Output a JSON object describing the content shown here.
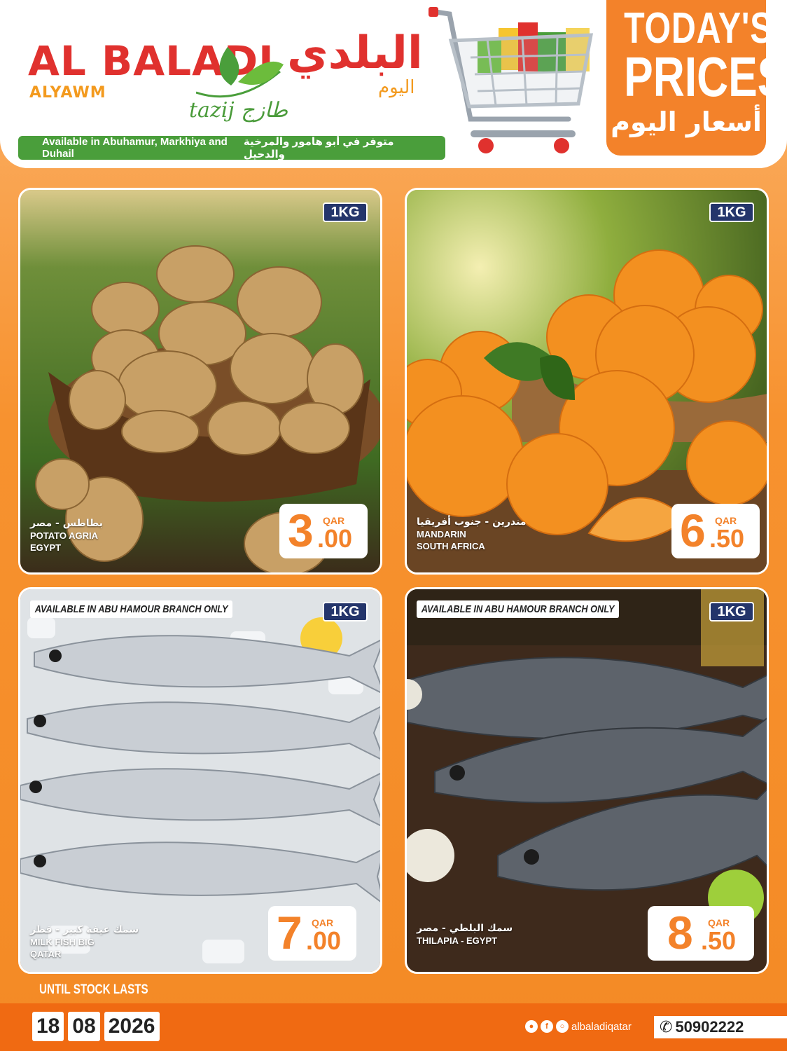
{
  "header": {
    "brand_en": "AL BALADI",
    "brand_en_sub": "ALYAWM",
    "brand_ar": "البلدي",
    "brand_ar_sub": "اليوم",
    "tagline_en": "tazij",
    "tagline_ar": "طازج",
    "availability_en": "Available in Abuhamur, Markhiya and Duhail",
    "availability_ar": "متوفر في أبو هامور والمرخية والدحيل",
    "todays_line1": "TODAY'S",
    "todays_line2": "PRICES",
    "todays_ar": "أسعار اليوم"
  },
  "products": [
    {
      "unit": "1KG",
      "name_ar": "بطاطس - مصر",
      "name_en_1": "POTATO AGRIA",
      "name_en_2": "EGYPT",
      "price_int": "3",
      "price_dec": ".00",
      "currency": "QAR",
      "note": ""
    },
    {
      "unit": "1KG",
      "name_ar": "مندرين - جنوب أفريقيا",
      "name_en_1": "MANDARIN",
      "name_en_2": "SOUTH AFRICA",
      "price_int": "6",
      "price_dec": ".50",
      "currency": "QAR",
      "note": ""
    },
    {
      "unit": "1KG",
      "name_ar": "سمك عيفة كبير - قطر",
      "name_en_1": "MILK FISH BIG",
      "name_en_2": "QATAR",
      "price_int": "7",
      "price_dec": ".00",
      "currency": "QAR",
      "note": "AVAILABLE IN ABU HAMOUR BRANCH ONLY"
    },
    {
      "unit": "1KG",
      "name_ar": "سمك البلطي - مصر",
      "name_en_1": "THILAPIA - EGYPT",
      "name_en_2": "",
      "price_int": "8",
      "price_dec": ".50",
      "currency": "QAR",
      "note": "AVAILABLE IN ABU HAMOUR BRANCH ONLY"
    }
  ],
  "footer": {
    "until": "UNTIL STOCK LASTS",
    "date_day": "18",
    "date_month": "08",
    "date_year": "2026",
    "social_handle": "albaladiqatar",
    "phone": "50902222"
  },
  "colors": {
    "brand_red": "#e0312e",
    "orange": "#f3822a",
    "green": "#4a9e3b",
    "badge_navy": "#24356b"
  }
}
